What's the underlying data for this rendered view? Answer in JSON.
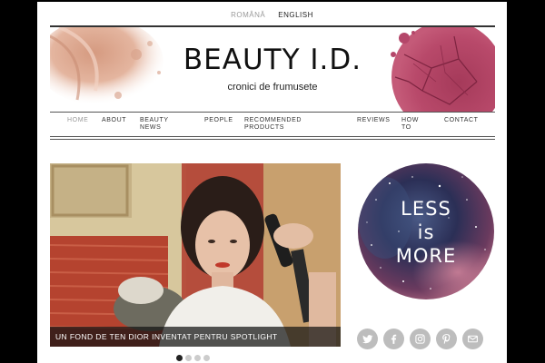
{
  "languages": [
    {
      "label": "ROMÂNĂ",
      "active": false
    },
    {
      "label": "ENGLISH",
      "active": true
    }
  ],
  "site": {
    "title": "BEAUTY I.D.",
    "tagline": "cronici de frumusete"
  },
  "nav": {
    "items": [
      {
        "label": "HOME",
        "active": true
      },
      {
        "label": "ABOUT"
      },
      {
        "label": "BEAUTY NEWS"
      },
      {
        "label": "PEOPLE"
      },
      {
        "label": "RECOMMENDED PRODUCTS"
      },
      {
        "label": "REVIEWS"
      },
      {
        "label": "HOW TO"
      },
      {
        "label": "CONTACT"
      }
    ]
  },
  "slider": {
    "caption": "UN FOND DE TEN DIOR INVENTAT PENTRU SPOTLIGHT",
    "active_index": 0,
    "dot_count": 4
  },
  "widget": {
    "line1": "LESS",
    "line2": "is",
    "line3": "MORE"
  },
  "social": {
    "icons": [
      "twitter-icon",
      "facebook-icon",
      "instagram-icon",
      "pinterest-icon",
      "email-icon"
    ]
  },
  "colors": {
    "accent_dark": "#222222",
    "social_grey": "#bdbdbd"
  }
}
